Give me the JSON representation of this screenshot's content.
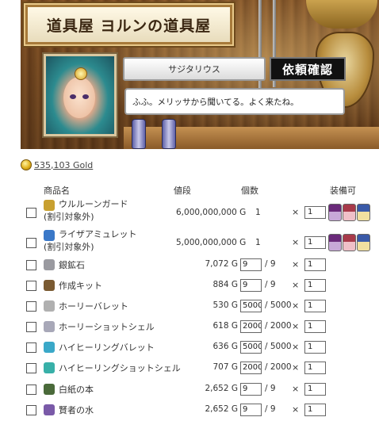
{
  "shop": {
    "title": "道具屋 ヨルンの道具屋",
    "npc_name": "サジタリウス",
    "request_button": "依頼確認",
    "dialogue": "ふふ。メリッサから聞いてる。よく来たね。"
  },
  "gold": {
    "amount": "535,103 Gold"
  },
  "table": {
    "headers": {
      "name": "商品名",
      "price": "値段",
      "count": "個数",
      "equip": "装備可"
    },
    "rows": [
      {
        "name": "ウルルーンガード",
        "note": "(割引対象外)",
        "price": "6,000,000,000 G",
        "count": "1",
        "qty": "1",
        "icon": "shield-gold-icon",
        "icon_color": "#c8a030"
      },
      {
        "name": "ライザアミュレット",
        "note": "(割引対象外)",
        "price": "5,000,000,000 G",
        "count": "1",
        "qty": "1",
        "icon": "amulet-icon",
        "icon_color": "#3a78c8"
      },
      {
        "name": "銀鉱石",
        "price": "7,072 G",
        "stock": "9",
        "max": "/ 9",
        "qty": "1",
        "icon": "ore-icon",
        "icon_color": "#9a9aa0"
      },
      {
        "name": "作成キット",
        "price": "884 G",
        "stock": "9",
        "max": "/ 9",
        "qty": "1",
        "icon": "kit-icon",
        "icon_color": "#7a5a32"
      },
      {
        "name": "ホーリーバレット",
        "price": "530 G",
        "stock": "5000",
        "max": "/ 5000",
        "qty": "1",
        "icon": "bullet-icon",
        "icon_color": "#b0b0b0"
      },
      {
        "name": "ホーリーショットシェル",
        "price": "618 G",
        "stock": "2000",
        "max": "/ 2000",
        "qty": "1",
        "icon": "shell-icon",
        "icon_color": "#a8a8b8"
      },
      {
        "name": "ハイヒーリングバレット",
        "price": "636 G",
        "stock": "5000",
        "max": "/ 5000",
        "qty": "1",
        "icon": "heal-bullet-icon",
        "icon_color": "#3aa8c8"
      },
      {
        "name": "ハイヒーリングショットシェル",
        "price": "707 G",
        "stock": "2000",
        "max": "/ 2000",
        "qty": "1",
        "icon": "heal-shell-icon",
        "icon_color": "#38b0a8"
      },
      {
        "name": "白紙の本",
        "price": "2,652 G",
        "stock": "9",
        "max": "/ 9",
        "qty": "1",
        "icon": "book-icon",
        "icon_color": "#4a6a3a"
      },
      {
        "name": "賢者の水",
        "price": "2,652 G",
        "stock": "9",
        "max": "/ 9",
        "qty": "1",
        "icon": "water-icon",
        "icon_color": "#7a5aa8"
      }
    ],
    "times": "×"
  }
}
